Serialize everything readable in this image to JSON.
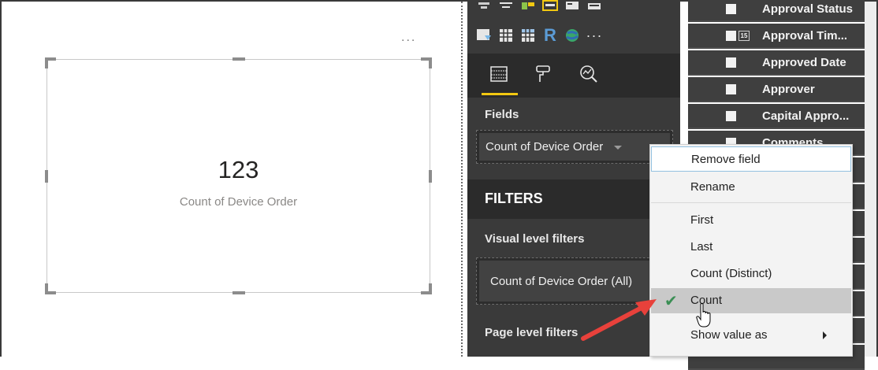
{
  "canvas": {
    "more_glyph": "...",
    "kpi_value": "123",
    "kpi_label": "Count of Device Order"
  },
  "pane": {
    "fields_label": "Fields",
    "field_pill": "Count of Device Order",
    "filters_title": "FILTERS",
    "visual_filters_label": "Visual level filters",
    "visual_filter_pill": "Count of Device Order (All)",
    "page_filters_label": "Page level filters",
    "viz_more": "···",
    "r_glyph": "R"
  },
  "fields_list": [
    {
      "label": "Approval Status"
    },
    {
      "label": "Approval Tim..."
    },
    {
      "label": "Approved Date"
    },
    {
      "label": "Approver"
    },
    {
      "label": "Capital Appro..."
    },
    {
      "label": "Comments"
    }
  ],
  "context_menu": {
    "remove_field": "Remove field",
    "rename": "Rename",
    "first": "First",
    "last": "Last",
    "count_distinct": "Count (Distinct)",
    "count": "Count",
    "show_value_as": "Show value as",
    "checked_item": "Count"
  },
  "colors": {
    "accent": "#f2c811",
    "pane_bg": "#3a3a3a",
    "arrow": "#e8413b",
    "check": "#3b8f55"
  }
}
